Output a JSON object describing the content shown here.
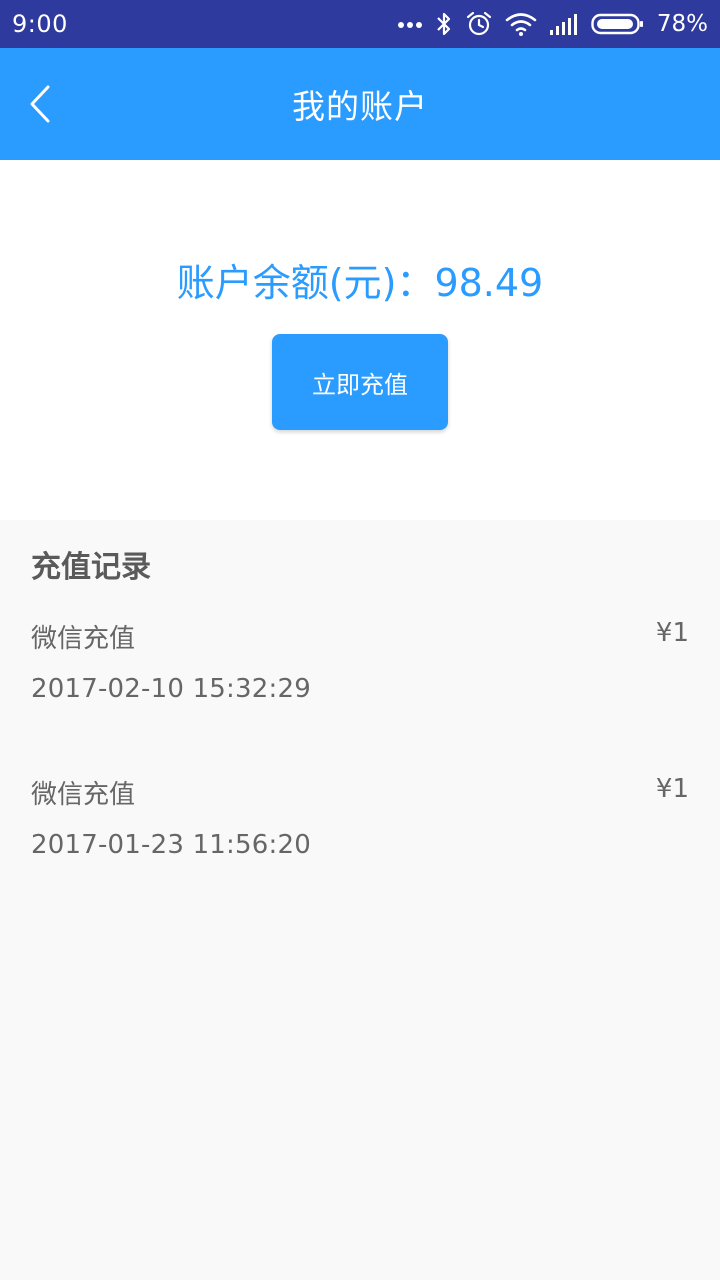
{
  "status_bar": {
    "time": "9:00",
    "battery": "78%",
    "icons": [
      "more-dots-icon",
      "bluetooth-icon",
      "alarm-icon",
      "wifi-icon",
      "signal-icon",
      "battery-icon"
    ]
  },
  "header": {
    "title": "我的账户",
    "back_icon": "chevron-left-icon"
  },
  "balance": {
    "label": "账户余额(元)",
    "separator": "：",
    "value": "98.49",
    "recharge_label": "立即充值"
  },
  "records": {
    "title": "充值记录",
    "items": [
      {
        "name": "微信充值",
        "amount": "¥1",
        "time": "2017-02-10 15:32:29"
      },
      {
        "name": "微信充值",
        "amount": "¥1",
        "time": "2017-01-23 11:56:20"
      }
    ]
  },
  "colors": {
    "status_bar": "#2f3a9e",
    "accent": "#2a9bff",
    "text_secondary": "#666666",
    "background": "#f9f9f9"
  }
}
